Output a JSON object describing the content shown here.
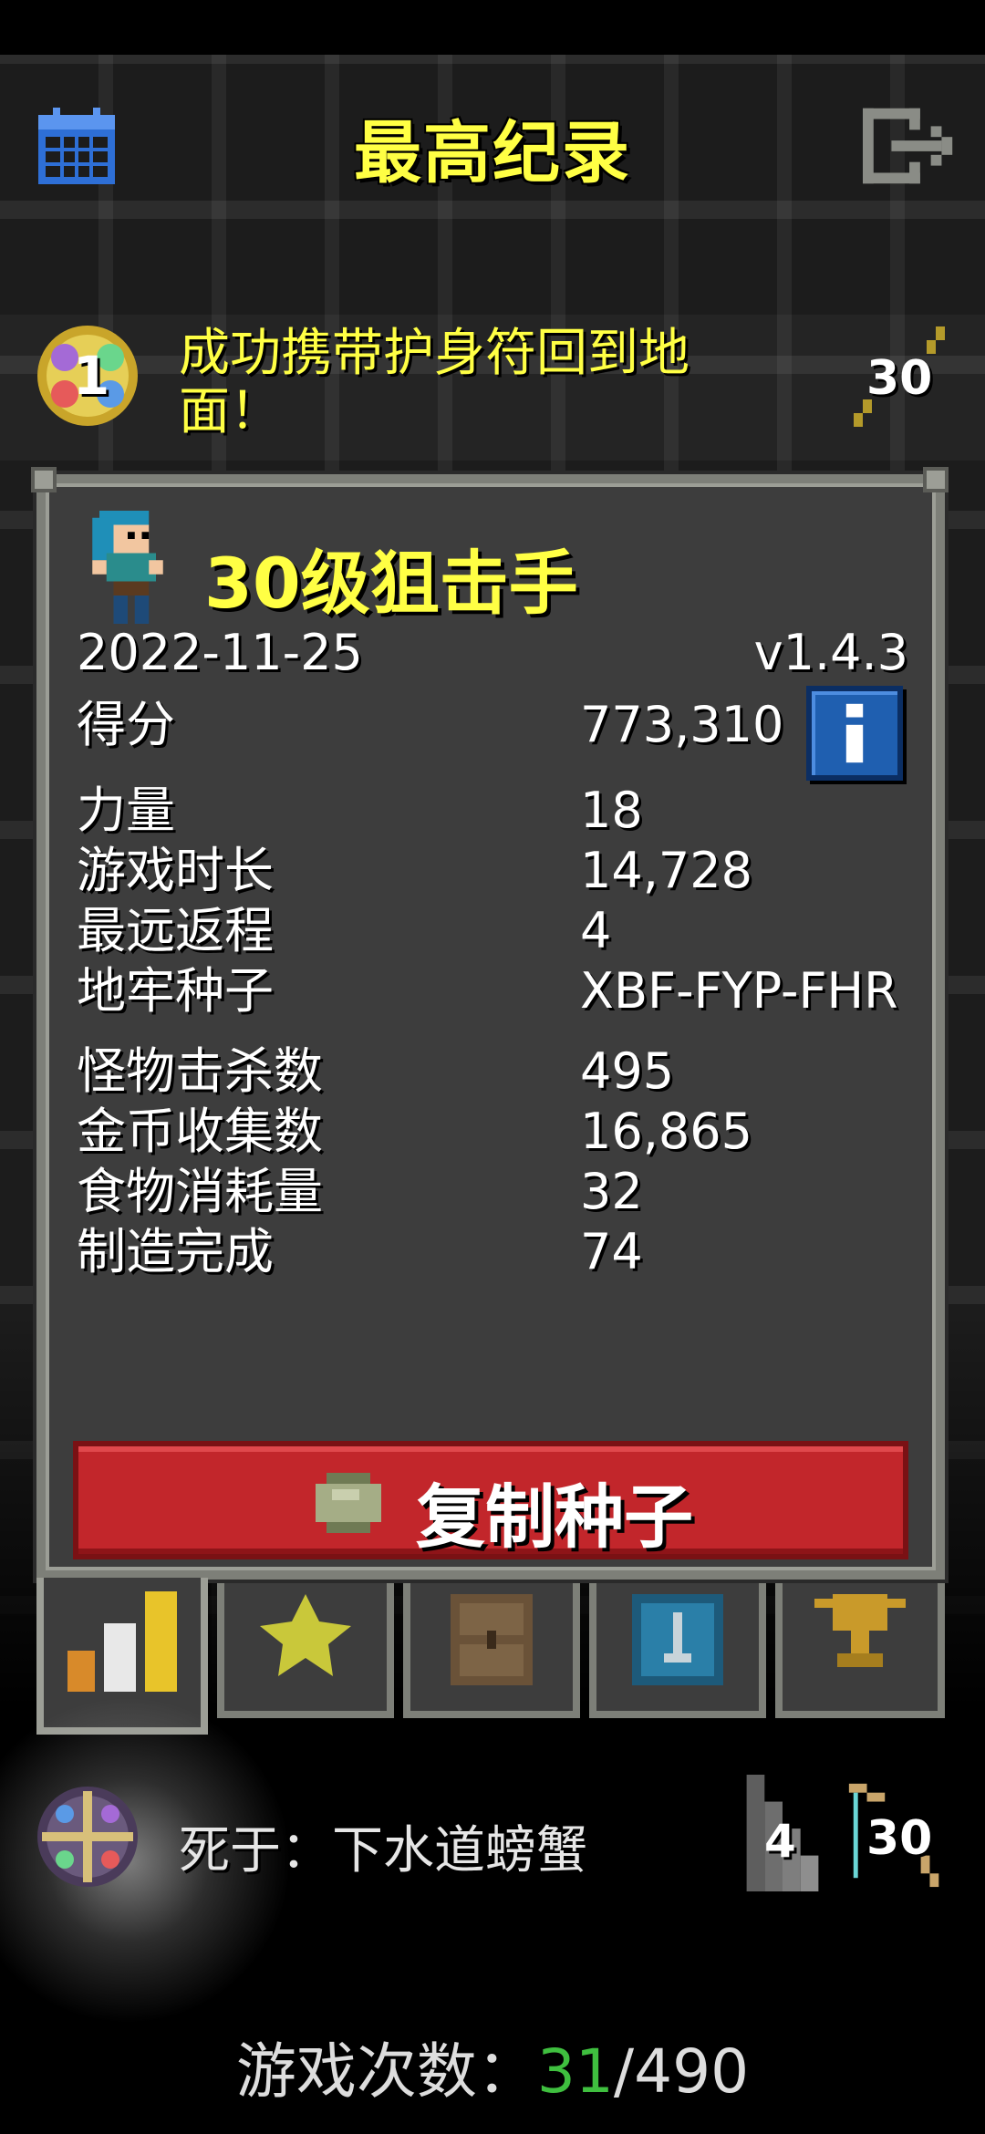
{
  "header": {
    "title": "最高纪录",
    "calendar_icon": "calendar-icon",
    "exit_icon": "exit-icon"
  },
  "record": {
    "rank": "1",
    "result": "成功携带护身符回到地面！",
    "weapon_level": "30"
  },
  "hero": {
    "title": "30级狙击手",
    "date": "2022-11-25",
    "version": "v1.4.3"
  },
  "stats": {
    "score_label": "得分",
    "score_value": "773,310",
    "strength_label": "力量",
    "strength_value": "18",
    "time_label": "游戏时长",
    "time_value": "14,728",
    "depth_label": "最远返程",
    "depth_value": "4",
    "seed_label": "地牢种子",
    "seed_value": "XBF-FYP-FHR",
    "kills_label": "怪物击杀数",
    "kills_value": "495",
    "gold_label": "金币收集数",
    "gold_value": "16,865",
    "food_label": "食物消耗量",
    "food_value": "32",
    "craft_label": "制造完成",
    "craft_value": "74"
  },
  "copy_seed_button": {
    "label": "复制种子"
  },
  "tabs": [
    {
      "icon": "stats-bars-icon",
      "active": true
    },
    {
      "icon": "star-icon",
      "active": false
    },
    {
      "icon": "backpack-icon",
      "active": false
    },
    {
      "icon": "armor-icon",
      "active": false
    },
    {
      "icon": "trophy-icon",
      "active": false
    }
  ],
  "death": {
    "text": "死于：下水道螃蟹",
    "depth": "4",
    "weapon_level": "30"
  },
  "games": {
    "label": "游戏次数：",
    "current": "31",
    "total": "/490"
  },
  "colors": {
    "title_yellow": "#ffff44",
    "copy_button_red": "#c2262b",
    "info_blue": "#1f5fb0",
    "highlight_green": "#3fbf3f"
  }
}
